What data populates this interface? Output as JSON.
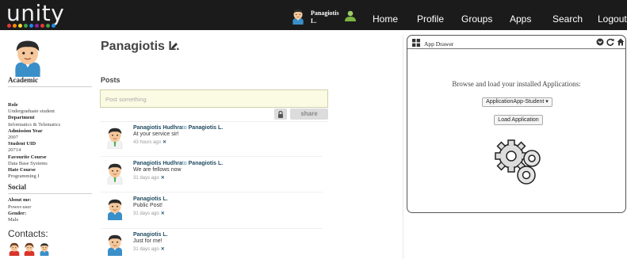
{
  "app": {
    "logo": "unity"
  },
  "topbar": {
    "user_name": "Panagiotis L.",
    "nav": [
      "Home",
      "Profile",
      "Groups",
      "Apps",
      "Search",
      "Logout"
    ]
  },
  "profile": {
    "name": "Panagiotis L.",
    "academic_title": "Academic",
    "academic": [
      {
        "label": "Role",
        "value": "Undergraduate student"
      },
      {
        "label": "Department",
        "value": "Informatics & Telematics"
      },
      {
        "label": "Admission Year",
        "value": "2007"
      },
      {
        "label": "Student UID",
        "value": "20714"
      },
      {
        "label": "Favourite Course",
        "value": "Data Base Systems"
      },
      {
        "label": "Hate Course",
        "value": "Programming I"
      }
    ],
    "social_title": "Social",
    "social": [
      {
        "label": "About me:",
        "value": "Power-user"
      },
      {
        "label": "Gender:",
        "value": "Male"
      }
    ],
    "contacts_title": "Contacts:"
  },
  "posts": {
    "title": "Posts",
    "placeholder": "Post something",
    "share_label": "share",
    "items": [
      {
        "author": "Panagiotis Hudhra",
        "to_word": "to",
        "recipient": "Panagiotis L.",
        "text": "At your service sir!",
        "time": "43 hours ago",
        "delete": "✕"
      },
      {
        "author": "Panagiotis Hudhra",
        "to_word": "to",
        "recipient": "Panagiotis L.",
        "text": "We are fellows now",
        "time": "31 days ago",
        "delete": "✕"
      },
      {
        "author": "Panagiotis L.",
        "to_word": "",
        "recipient": "",
        "text": "Public Post!",
        "time": "31 days ago",
        "delete": "✕"
      },
      {
        "author": "Panagiotis L.",
        "to_word": "",
        "recipient": "",
        "text": "Just for me!",
        "time": "31 days ago",
        "delete": "✕"
      }
    ]
  },
  "drawer": {
    "title": "App Drawer",
    "message": "Browse and load your installed Applications:",
    "selected_app": "ApplicationApp-Student",
    "load_label": "Load Application"
  },
  "colors": {
    "topbar": "#1b1b1b",
    "link": "#1f4b61",
    "post_box": "#fbfbe4"
  },
  "icons": [
    "avatar-icon",
    "friends-icon",
    "pencil-icon",
    "lock-icon",
    "grid-icon",
    "minimize-icon",
    "refresh-icon",
    "home-icon",
    "gears-icon"
  ]
}
